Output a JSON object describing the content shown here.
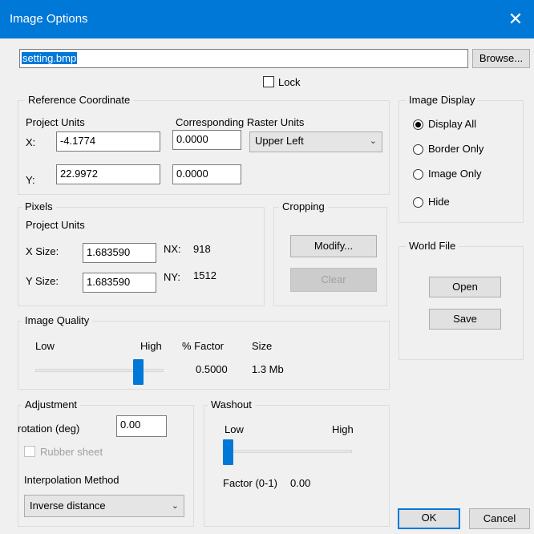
{
  "window": {
    "title": "Image Options",
    "close_glyph": "✕"
  },
  "file": {
    "value": "setting.bmp",
    "browse_label": "Browse..."
  },
  "lock": {
    "label": "Lock",
    "checked": false
  },
  "reference": {
    "legend": "Reference Coordinate",
    "project_units_label": "Project Units",
    "raster_units_label": "Corresponding Raster Units",
    "x_label": "X:",
    "y_label": "Y:",
    "x_value": "-4.1774",
    "y_value": "22.9972",
    "raster_x_value": "0.0000",
    "raster_y_value": "0.0000",
    "origin_selected": "Upper Left"
  },
  "pixels": {
    "legend": "Pixels",
    "project_units_label": "Project Units",
    "xsize_label": "X Size:",
    "ysize_label": "Y Size:",
    "xsize_value": "1.683590",
    "ysize_value": "1.683590",
    "nx_label": "NX:",
    "nx_value": "918",
    "ny_label": "NY:",
    "ny_value": "1512"
  },
  "cropping": {
    "legend": "Cropping",
    "modify_label": "Modify...",
    "clear_label": "Clear"
  },
  "image_display": {
    "legend": "Image Display",
    "options": [
      "Display All",
      "Border Only",
      "Image Only",
      "Hide"
    ],
    "selected_index": 0
  },
  "world_file": {
    "legend": "World File",
    "open_label": "Open",
    "save_label": "Save"
  },
  "image_quality": {
    "legend": "Image Quality",
    "low_label": "Low",
    "high_label": "High",
    "factor_header": "% Factor",
    "size_header": "Size",
    "factor_value": "0.5000",
    "size_value": "1.3 Mb",
    "slider_fraction": 0.8
  },
  "adjustment": {
    "legend": "Adjustment",
    "rotation_label": "rotation (deg)",
    "rotation_value": "0.00",
    "rubber_sheet_label": "Rubber sheet",
    "interpolation_label": "Interpolation Method",
    "interpolation_selected": "Inverse distance"
  },
  "washout": {
    "legend": "Washout",
    "low_label": "Low",
    "high_label": "High",
    "factor_label": "Factor (0-1)",
    "factor_value": "0.00",
    "slider_fraction": 0.0
  },
  "footer": {
    "ok_label": "OK",
    "cancel_label": "Cancel"
  },
  "colors": {
    "titlebar": "#0078d7",
    "slider_thumb": "#0078d7",
    "selection": "#0078d7"
  },
  "icons": {
    "dropdown": "chevron-down-icon",
    "close": "close-icon"
  }
}
